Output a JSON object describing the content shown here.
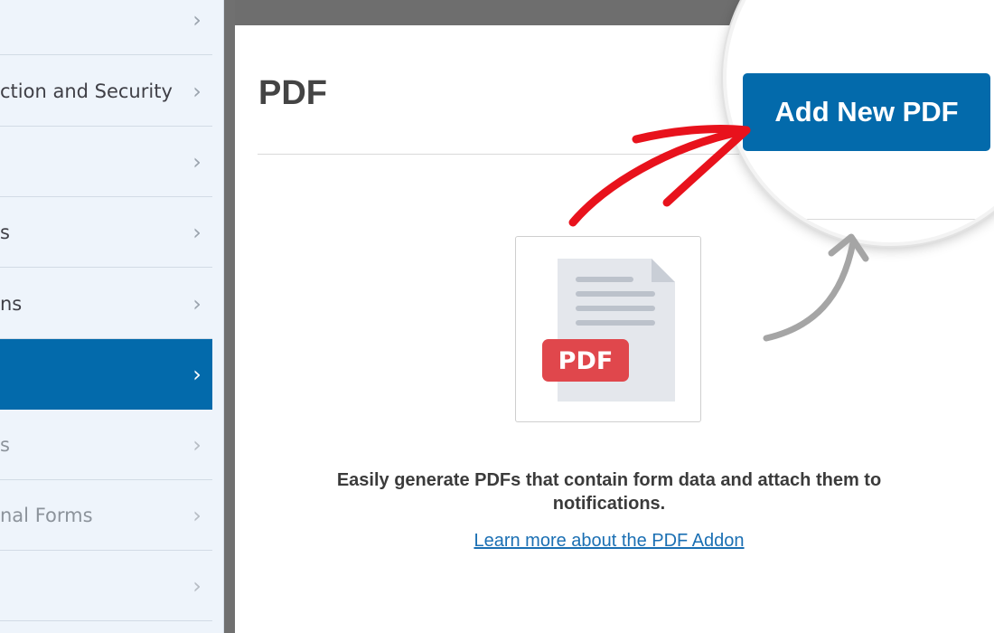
{
  "sidebar": {
    "items": [
      {
        "label": "",
        "state": "normal"
      },
      {
        "label": "ction and Security",
        "state": "normal"
      },
      {
        "label": "",
        "state": "normal"
      },
      {
        "label": "s",
        "state": "normal"
      },
      {
        "label": "ns",
        "state": "normal"
      },
      {
        "label": "",
        "state": "active"
      },
      {
        "label": "s",
        "state": "muted"
      },
      {
        "label": "nal Forms",
        "state": "muted"
      },
      {
        "label": "",
        "state": "muted"
      }
    ]
  },
  "main": {
    "title": "PDF",
    "add_button_label": "Add New PDF",
    "icon_badge": "PDF",
    "empty_text": "Easily generate PDFs that contain form data and attach them to notifications.",
    "learn_more_link": "Learn more about the PDF Addon"
  },
  "colors": {
    "accent": "#036aab",
    "arrow": "#e8121c",
    "badge": "#e0474c",
    "sidebar_bg": "#eef4fb"
  },
  "icons": {
    "chevron": "chevron-right-icon",
    "document": "pdf-document-icon",
    "arrow": "red-hand-drawn-arrow",
    "curve": "gray-curved-arrow"
  }
}
